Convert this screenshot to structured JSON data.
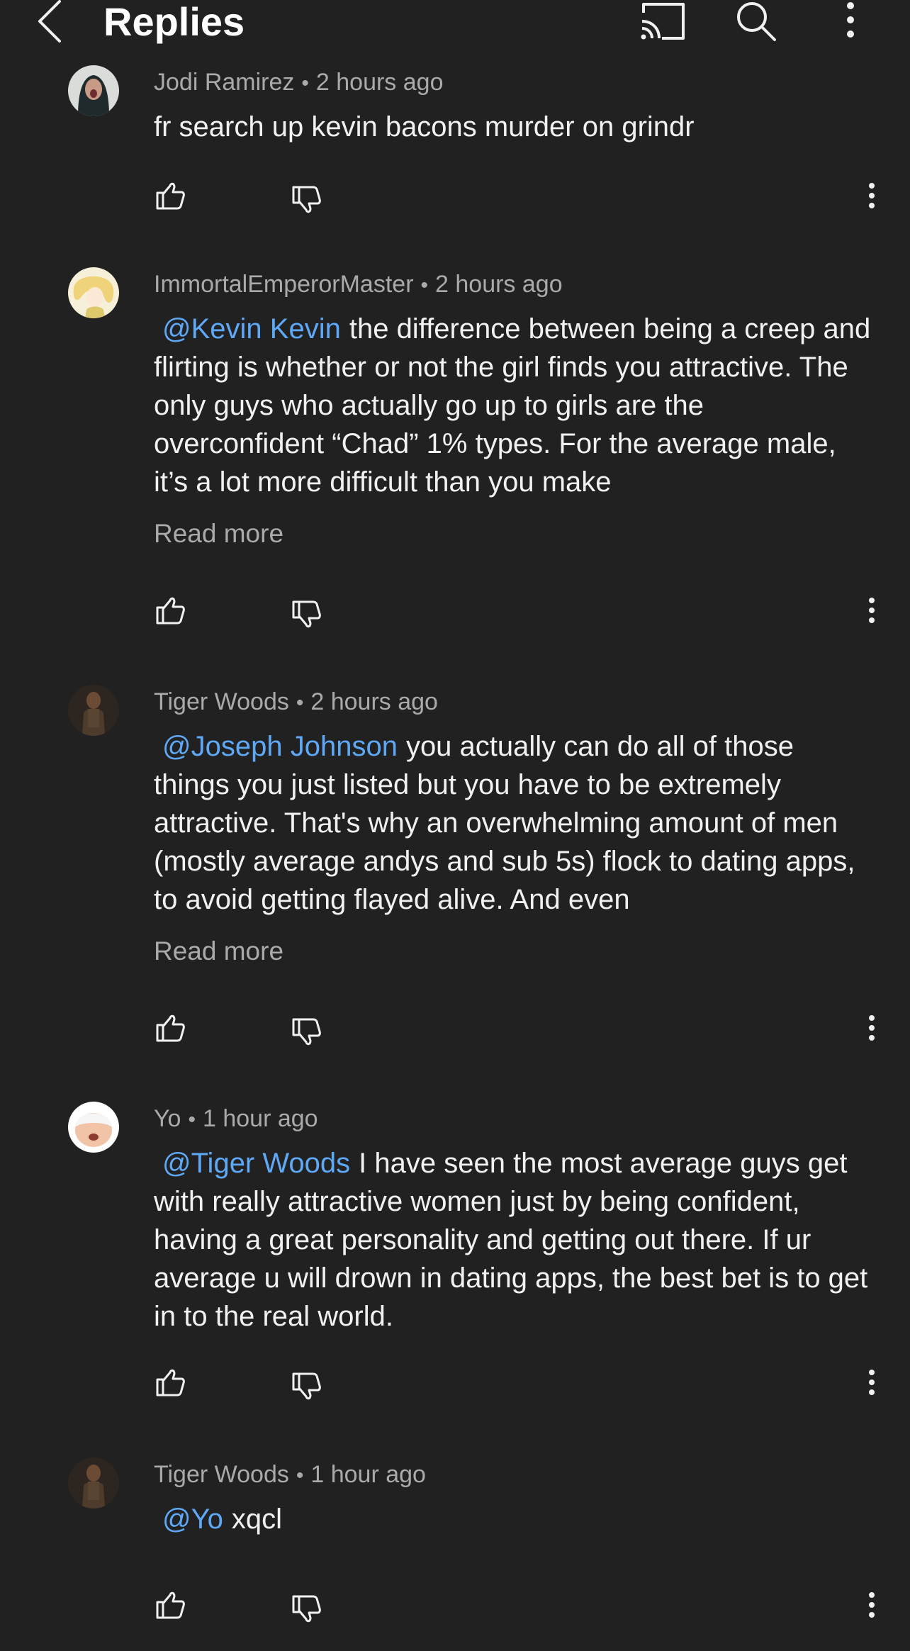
{
  "header": {
    "title": "Replies",
    "icons": {
      "back": "back-arrow-icon",
      "cast": "cast-icon",
      "search": "search-icon",
      "more": "more-vert-icon"
    }
  },
  "colors": {
    "background": "#212121",
    "text": "#f1f1f1",
    "secondary_text": "#aaaaaa",
    "mention": "#5fa8f5"
  },
  "comments": [
    {
      "author": "Jodi Ramirez",
      "time": "2 hours ago",
      "mention": "",
      "text": "fr search up kevin bacons murder on grindr",
      "read_more": ""
    },
    {
      "author": "ImmortalEmperorMaster",
      "time": "2 hours ago",
      "mention": "@Kevin Kevin",
      "text": "the difference between being a creep and flirting is whether or not the girl finds you attractive. The only guys who actually go up to girls are the overconfident “Chad” 1% types. For the average male, it’s a lot more difficult than you make",
      "read_more": "Read more"
    },
    {
      "author": "Tiger Woods",
      "time": "2 hours ago",
      "mention": "@Joseph Johnson",
      "text": "you actually can do all of those things you just listed but you have to be extremely attractive. That's why an overwhelming amount of men (mostly average andys and sub 5s) flock to dating apps, to avoid getting flayed alive. And even",
      "read_more": "Read more"
    },
    {
      "author": "Yo",
      "time": "1 hour ago",
      "mention": "@Tiger Woods",
      "text": "I have seen the most average guys get with really attractive women just by being confident, having a great personality and getting out there. If ur average u will drown in dating apps, the best bet is to get in to the real world.",
      "read_more": ""
    },
    {
      "author": "Tiger Woods",
      "time": "1 hour ago",
      "mention": "@Yo",
      "text": "xqcl",
      "read_more": ""
    }
  ]
}
